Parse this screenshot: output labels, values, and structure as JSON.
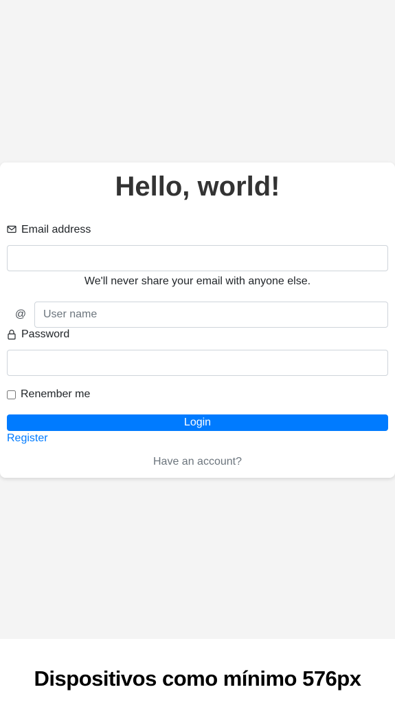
{
  "title": "Hello, world!",
  "email": {
    "label": "Email address",
    "value": "",
    "help": "We'll never share your email with anyone else."
  },
  "username": {
    "prefix": "@",
    "placeholder": "User name",
    "value": ""
  },
  "password": {
    "label": "Password",
    "value": ""
  },
  "remember": {
    "label": "Renember me",
    "checked": false
  },
  "login_label": "Login",
  "register_label": "Register",
  "account_text": "Have an account?",
  "caption": "Dispositivos como mínimo 576px",
  "colors": {
    "primary": "#007bff",
    "page_bg": "#f4f4f4",
    "card_bg": "#ffffff",
    "muted": "#6c757d"
  },
  "icons": {
    "email": "envelope-icon",
    "password": "lock-icon"
  }
}
